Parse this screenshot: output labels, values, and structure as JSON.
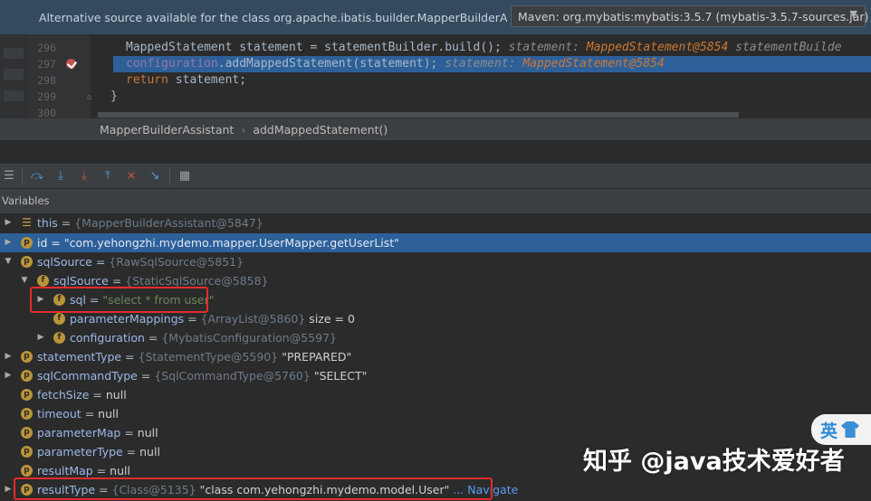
{
  "banner": {
    "text": "Alternative source available for the class org.apache.ibatis.builder.MapperBuilderAssist...",
    "source_value": "Maven: org.mybatis:mybatis:3.5.7 (mybatis-3.5.7-sources.jar)"
  },
  "editor": {
    "lines": [
      {
        "num": "296",
        "code": "MappedStatement statement = statementBuilder.build();",
        "inline_label": "statement:",
        "inline_value": "MappedStatement@5854",
        "inline_extra": "statementBuilde"
      },
      {
        "num": "297",
        "code_field": "configuration",
        "code_rest": ".addMappedStatement(statement);",
        "inline_label": "statement:",
        "inline_value": "MappedStatement@5854"
      },
      {
        "num": "298",
        "code_kw": "return",
        "code_rest": " statement;"
      },
      {
        "num": "299",
        "code": "}"
      },
      {
        "num": "300",
        "code": ""
      }
    ]
  },
  "breadcrumb": {
    "class": "MapperBuilderAssistant",
    "method": "addMappedStatement()"
  },
  "toolbar": {
    "icons": [
      "layout-icon",
      "step-over-icon",
      "step-into-icon",
      "force-step-into-icon",
      "step-out-icon",
      "drop-frame-icon",
      "run-to-cursor-icon",
      "evaluate-icon"
    ]
  },
  "variables": {
    "header": "Variables",
    "rows": [
      {
        "name": "this",
        "eq": " = ",
        "ref": "{MapperBuilderAssistant@5847}",
        "value": ""
      },
      {
        "name": "id",
        "eq": " = ",
        "ref": "",
        "value": "\"com.yehongzhi.mydemo.mapper.UserMapper.getUserList\""
      },
      {
        "name": "sqlSource",
        "eq": " = ",
        "ref": "{RawSqlSource@5851}",
        "value": ""
      },
      {
        "name": "sqlSource",
        "eq": " = ",
        "ref": "{StaticSqlSource@5858}",
        "value": ""
      },
      {
        "name": "sql",
        "eq": " = ",
        "ref": "",
        "value": "\"select * from user\""
      },
      {
        "name": "parameterMappings",
        "eq": " = ",
        "ref": "{ArrayList@5860}",
        "value": "  size = 0"
      },
      {
        "name": "configuration",
        "eq": " = ",
        "ref": "{MybatisConfiguration@5597}",
        "value": ""
      },
      {
        "name": "statementType",
        "eq": " = ",
        "ref": "{StatementType@5590}",
        "value": " \"PREPARED\""
      },
      {
        "name": "sqlCommandType",
        "eq": " = ",
        "ref": "{SqlCommandType@5760}",
        "value": " \"SELECT\""
      },
      {
        "name": "fetchSize",
        "eq": " = ",
        "ref": "",
        "value": "null"
      },
      {
        "name": "timeout",
        "eq": " = ",
        "ref": "",
        "value": "null"
      },
      {
        "name": "parameterMap",
        "eq": " = ",
        "ref": "",
        "value": "null"
      },
      {
        "name": "parameterType",
        "eq": " = ",
        "ref": "",
        "value": "null"
      },
      {
        "name": "resultMap",
        "eq": " = ",
        "ref": "",
        "value": "null"
      },
      {
        "name": "resultType",
        "eq": " = ",
        "ref": "{Class@5135}",
        "value": " \"class com.yehongzhi.mydemo.model.User\"",
        "nav": " ... Navigate"
      }
    ]
  },
  "watermark": "知乎 @java技术爱好者",
  "ime": {
    "label": "英"
  },
  "colors": {
    "selection": "#2d6099",
    "highlight_box": "#e52b2b",
    "banner": "#344a5f"
  }
}
